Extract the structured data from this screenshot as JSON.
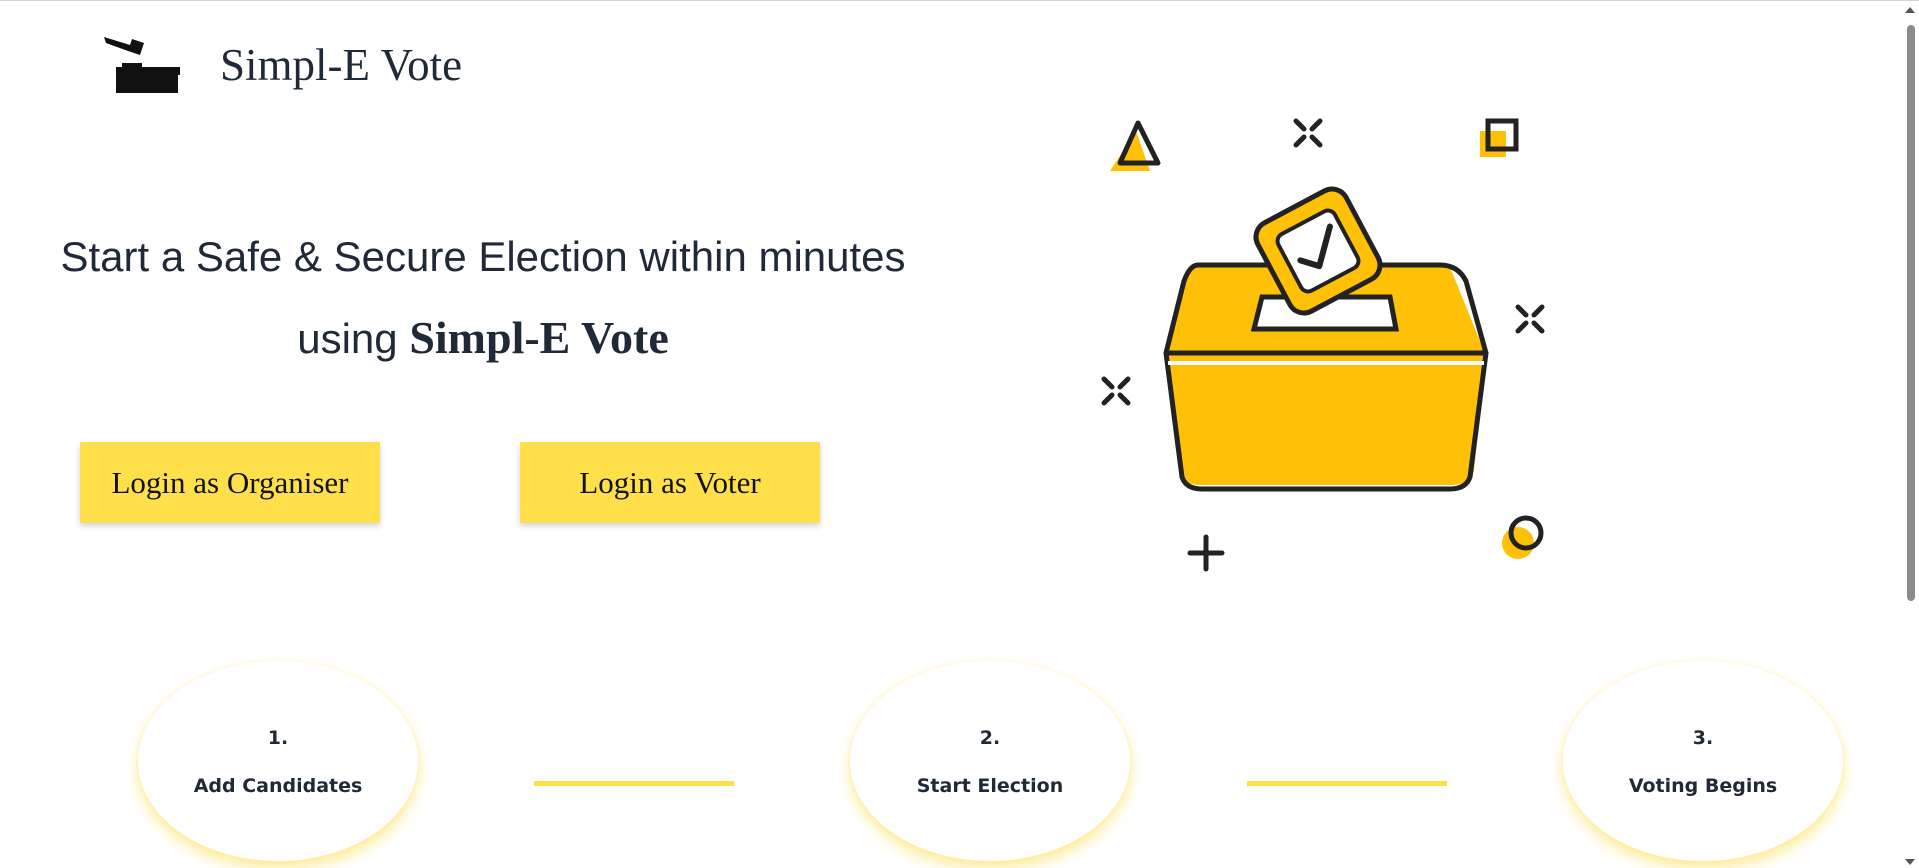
{
  "header": {
    "brand_name": "Simpl-E Vote",
    "logo_icon": "ballot-drop-icon"
  },
  "hero": {
    "line1": "Start a Safe & Secure Election within minutes",
    "line2_prefix": "using ",
    "line2_brand": "Simpl-E Vote"
  },
  "actions": {
    "organiser_label": "Login as Organiser",
    "voter_label": "Login as Voter"
  },
  "illustration": {
    "icon": "ballot-box-illustration",
    "accent_color": "#ffc107"
  },
  "steps": [
    {
      "number": "1.",
      "label": "Add Candidates"
    },
    {
      "number": "2.",
      "label": "Start Election"
    },
    {
      "number": "3.",
      "label": "Voting Begins"
    }
  ],
  "colors": {
    "button_bg": "#ffe04b",
    "connector": "#fde047",
    "text": "#1f2937"
  }
}
